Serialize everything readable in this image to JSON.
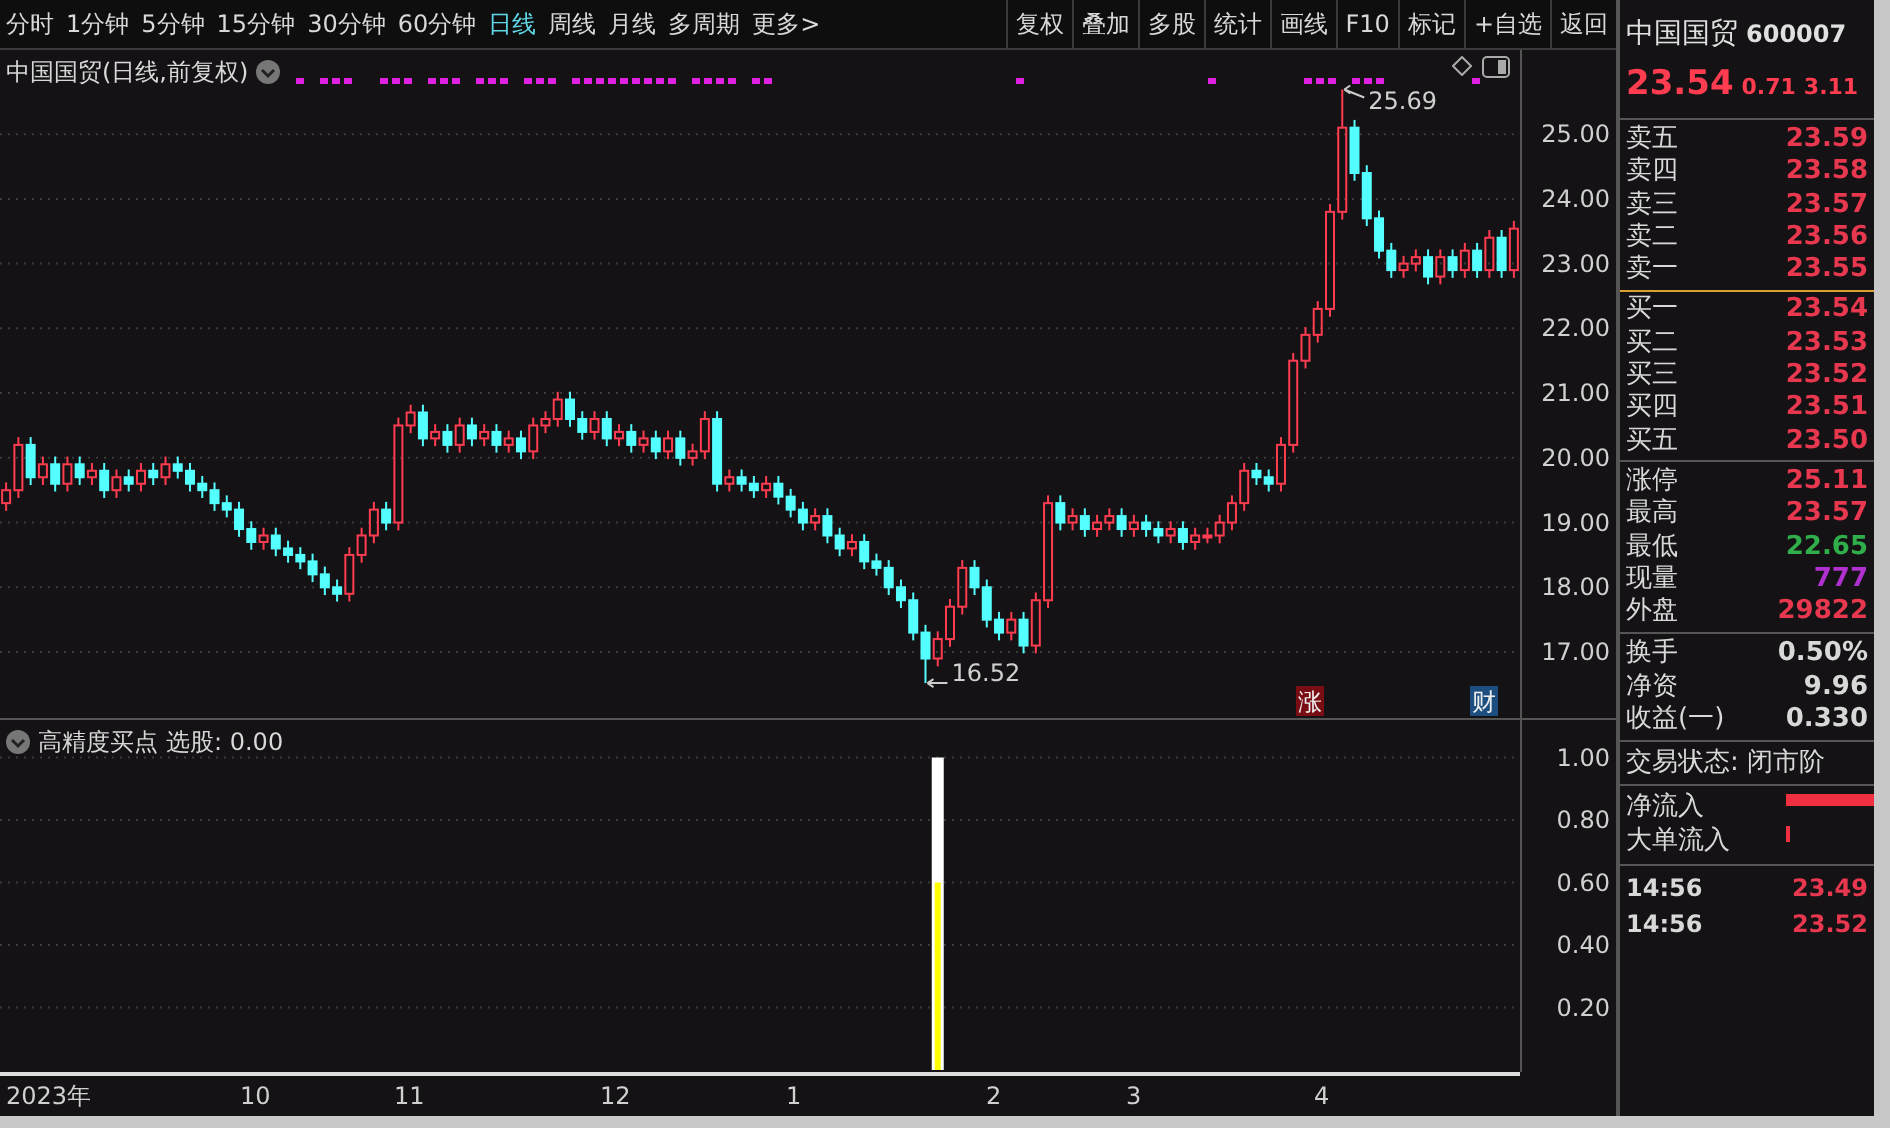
{
  "toolbar": {
    "periods": [
      {
        "label": "分时",
        "selected": false
      },
      {
        "label": "1分钟",
        "selected": false
      },
      {
        "label": "5分钟",
        "selected": false
      },
      {
        "label": "15分钟",
        "selected": false
      },
      {
        "label": "30分钟",
        "selected": false
      },
      {
        "label": "60分钟",
        "selected": false
      },
      {
        "label": "日线",
        "selected": true
      },
      {
        "label": "周线",
        "selected": false
      },
      {
        "label": "月线",
        "selected": false
      },
      {
        "label": "多周期",
        "selected": false
      },
      {
        "label": "更多>",
        "selected": false
      }
    ],
    "actions": [
      "复权",
      "叠加",
      "多股",
      "统计",
      "画线",
      "F10",
      "标记",
      "+自选",
      "返回"
    ]
  },
  "price_chart": {
    "title": "中国国贸(日线,前复权)",
    "chart_data": {
      "type": "candlestick",
      "grid": true,
      "ohlc": [
        [
          19.3,
          19.62,
          19.18,
          19.5
        ],
        [
          19.5,
          20.32,
          19.38,
          20.2
        ],
        [
          20.2,
          20.32,
          19.58,
          19.7
        ],
        [
          19.7,
          20.02,
          19.58,
          19.9
        ],
        [
          19.9,
          20.02,
          19.48,
          19.6
        ],
        [
          19.6,
          20.02,
          19.48,
          19.9
        ],
        [
          19.9,
          20.02,
          19.58,
          19.7
        ],
        [
          19.7,
          19.92,
          19.58,
          19.8
        ],
        [
          19.8,
          19.92,
          19.38,
          19.5
        ],
        [
          19.5,
          19.82,
          19.38,
          19.7
        ],
        [
          19.7,
          19.82,
          19.48,
          19.6
        ],
        [
          19.6,
          19.92,
          19.48,
          19.8
        ],
        [
          19.8,
          19.92,
          19.58,
          19.7
        ],
        [
          19.7,
          20.02,
          19.58,
          19.9
        ],
        [
          19.9,
          20.02,
          19.68,
          19.8
        ],
        [
          19.8,
          19.92,
          19.48,
          19.6
        ],
        [
          19.6,
          19.72,
          19.38,
          19.5
        ],
        [
          19.5,
          19.62,
          19.18,
          19.3
        ],
        [
          19.3,
          19.42,
          19.08,
          19.2
        ],
        [
          19.2,
          19.32,
          18.78,
          18.9
        ],
        [
          18.9,
          19.02,
          18.58,
          18.7
        ],
        [
          18.7,
          18.92,
          18.58,
          18.8
        ],
        [
          18.8,
          18.92,
          18.48,
          18.6
        ],
        [
          18.6,
          18.72,
          18.38,
          18.5
        ],
        [
          18.5,
          18.62,
          18.28,
          18.4
        ],
        [
          18.4,
          18.52,
          18.08,
          18.2
        ],
        [
          18.2,
          18.32,
          17.88,
          18.0
        ],
        [
          18.0,
          18.12,
          17.78,
          17.9
        ],
        [
          17.9,
          18.62,
          17.78,
          18.5
        ],
        [
          18.5,
          18.92,
          18.38,
          18.8
        ],
        [
          18.8,
          19.32,
          18.68,
          19.2
        ],
        [
          19.2,
          19.32,
          18.88,
          19.0
        ],
        [
          19.0,
          20.62,
          18.88,
          20.5
        ],
        [
          20.5,
          20.82,
          20.38,
          20.7
        ],
        [
          20.7,
          20.82,
          20.18,
          20.3
        ],
        [
          20.3,
          20.52,
          20.18,
          20.4
        ],
        [
          20.4,
          20.52,
          20.08,
          20.2
        ],
        [
          20.2,
          20.62,
          20.08,
          20.5
        ],
        [
          20.5,
          20.62,
          20.18,
          20.3
        ],
        [
          20.3,
          20.52,
          20.18,
          20.4
        ],
        [
          20.4,
          20.52,
          20.08,
          20.2
        ],
        [
          20.2,
          20.42,
          20.08,
          20.3
        ],
        [
          20.3,
          20.42,
          19.98,
          20.1
        ],
        [
          20.1,
          20.62,
          19.98,
          20.5
        ],
        [
          20.5,
          20.72,
          20.38,
          20.6
        ],
        [
          20.6,
          21.02,
          20.48,
          20.9
        ],
        [
          20.9,
          21.02,
          20.48,
          20.6
        ],
        [
          20.6,
          20.72,
          20.28,
          20.4
        ],
        [
          20.4,
          20.72,
          20.28,
          20.6
        ],
        [
          20.6,
          20.72,
          20.18,
          20.3
        ],
        [
          20.3,
          20.52,
          20.18,
          20.4
        ],
        [
          20.4,
          20.52,
          20.08,
          20.2
        ],
        [
          20.2,
          20.42,
          20.08,
          20.3
        ],
        [
          20.3,
          20.42,
          19.98,
          20.1
        ],
        [
          20.1,
          20.42,
          19.98,
          20.3
        ],
        [
          20.3,
          20.42,
          19.88,
          20.0
        ],
        [
          20.0,
          20.22,
          19.88,
          20.1
        ],
        [
          20.1,
          20.72,
          19.98,
          20.6
        ],
        [
          20.6,
          20.72,
          19.48,
          19.6
        ],
        [
          19.6,
          19.82,
          19.48,
          19.7
        ],
        [
          19.7,
          19.82,
          19.48,
          19.6
        ],
        [
          19.6,
          19.72,
          19.38,
          19.5
        ],
        [
          19.5,
          19.72,
          19.38,
          19.6
        ],
        [
          19.6,
          19.72,
          19.28,
          19.4
        ],
        [
          19.4,
          19.52,
          19.08,
          19.2
        ],
        [
          19.2,
          19.32,
          18.88,
          19.0
        ],
        [
          19.0,
          19.22,
          18.88,
          19.1
        ],
        [
          19.1,
          19.22,
          18.68,
          18.8
        ],
        [
          18.8,
          18.92,
          18.48,
          18.6
        ],
        [
          18.6,
          18.82,
          18.48,
          18.7
        ],
        [
          18.7,
          18.82,
          18.28,
          18.4
        ],
        [
          18.4,
          18.52,
          18.18,
          18.3
        ],
        [
          18.3,
          18.42,
          17.88,
          18.0
        ],
        [
          18.0,
          18.12,
          17.68,
          17.8
        ],
        [
          17.8,
          17.92,
          17.18,
          17.3
        ],
        [
          17.3,
          17.42,
          16.52,
          16.9
        ],
        [
          16.9,
          17.32,
          16.78,
          17.2
        ],
        [
          17.2,
          17.82,
          17.08,
          17.7
        ],
        [
          17.7,
          18.42,
          17.58,
          18.3
        ],
        [
          18.3,
          18.42,
          17.88,
          18.0
        ],
        [
          18.0,
          18.12,
          17.38,
          17.5
        ],
        [
          17.5,
          17.62,
          17.18,
          17.3
        ],
        [
          17.3,
          17.62,
          17.18,
          17.5
        ],
        [
          17.5,
          17.62,
          16.98,
          17.1
        ],
        [
          17.1,
          17.92,
          16.98,
          17.8
        ],
        [
          17.8,
          19.42,
          17.68,
          19.3
        ],
        [
          19.3,
          19.42,
          18.88,
          19.0
        ],
        [
          19.0,
          19.22,
          18.88,
          19.1
        ],
        [
          19.1,
          19.22,
          18.78,
          18.9
        ],
        [
          18.9,
          19.12,
          18.78,
          19.0
        ],
        [
          19.0,
          19.22,
          18.88,
          19.1
        ],
        [
          19.1,
          19.22,
          18.78,
          18.9
        ],
        [
          18.9,
          19.12,
          18.78,
          19.0
        ],
        [
          19.0,
          19.12,
          18.78,
          18.9
        ],
        [
          18.9,
          19.02,
          18.68,
          18.8
        ],
        [
          18.8,
          19.02,
          18.68,
          18.9
        ],
        [
          18.9,
          19.02,
          18.58,
          18.7
        ],
        [
          18.7,
          18.92,
          18.58,
          18.8
        ],
        [
          18.8,
          18.92,
          18.68,
          18.8
        ],
        [
          18.8,
          19.12,
          18.68,
          19.0
        ],
        [
          19.0,
          19.42,
          18.88,
          19.3
        ],
        [
          19.3,
          19.92,
          19.18,
          19.8
        ],
        [
          19.8,
          19.92,
          19.58,
          19.7
        ],
        [
          19.7,
          19.82,
          19.48,
          19.6
        ],
        [
          19.6,
          20.32,
          19.48,
          20.2
        ],
        [
          20.2,
          21.62,
          20.08,
          21.5
        ],
        [
          21.5,
          22.02,
          21.38,
          21.9
        ],
        [
          21.9,
          22.42,
          21.78,
          22.3
        ],
        [
          22.3,
          23.92,
          22.18,
          23.8
        ],
        [
          23.8,
          25.69,
          23.68,
          25.1
        ],
        [
          25.1,
          25.22,
          24.28,
          24.4
        ],
        [
          24.4,
          24.52,
          23.58,
          23.7
        ],
        [
          23.7,
          23.82,
          23.08,
          23.2
        ],
        [
          23.2,
          23.32,
          22.78,
          22.9
        ],
        [
          22.9,
          23.12,
          22.78,
          23.0
        ],
        [
          23.0,
          23.22,
          22.88,
          23.1
        ],
        [
          23.1,
          23.22,
          22.68,
          22.8
        ],
        [
          22.8,
          23.22,
          22.68,
          23.1
        ],
        [
          23.1,
          23.22,
          22.78,
          22.9
        ],
        [
          22.9,
          23.32,
          22.78,
          23.2
        ],
        [
          23.2,
          23.32,
          22.78,
          22.9
        ],
        [
          22.9,
          23.52,
          22.78,
          23.4
        ],
        [
          23.4,
          23.52,
          22.78,
          22.9
        ],
        [
          22.9,
          23.66,
          22.78,
          23.54
        ]
      ],
      "ylim": [
        15.95,
        26.3
      ],
      "yticks": [
        {
          "value": 17,
          "label": "17.00"
        },
        {
          "value": 18,
          "label": "18.00"
        },
        {
          "value": 19,
          "label": "19.00"
        },
        {
          "value": 20,
          "label": "20.00"
        },
        {
          "value": 21,
          "label": "21.00"
        },
        {
          "value": 22,
          "label": "22.00"
        },
        {
          "value": 23,
          "label": "23.00"
        },
        {
          "value": 24,
          "label": "24.00"
        },
        {
          "value": 25,
          "label": "25.00"
        }
      ],
      "annotations": [
        "25.69",
        "16.52",
        "涨",
        "财"
      ]
    }
  },
  "time_axis": {
    "labels": [
      "2023年",
      "10",
      "11",
      "12",
      "1",
      "2",
      "3",
      "4"
    ]
  },
  "indicator_chart": {
    "name": "高精度买点",
    "reading": "选股: 0.00",
    "chart_data": {
      "type": "bar",
      "grid": true,
      "ylim": [
        0,
        1.12
      ],
      "yticks": [
        {
          "value": 0.2,
          "label": "0.20"
        },
        {
          "value": 0.4,
          "label": "0.40"
        },
        {
          "value": 0.6,
          "label": "0.60"
        },
        {
          "value": 0.8,
          "label": "0.80"
        },
        {
          "value": 1,
          "label": "1.00"
        }
      ],
      "series": [
        {
          "color": "#ffffff",
          "values": [
            0,
            0,
            0,
            0,
            0,
            0,
            0,
            0,
            0,
            0,
            0,
            0,
            0,
            0,
            0,
            0,
            0,
            0,
            0,
            0,
            0,
            0,
            0,
            0,
            0,
            0,
            0,
            0,
            0,
            0,
            0,
            0,
            0,
            0,
            0,
            0,
            0,
            0,
            0,
            0,
            0,
            0,
            0,
            0,
            0,
            0,
            0,
            0,
            0,
            0,
            0,
            0,
            0,
            0,
            0,
            0,
            0,
            0,
            0,
            0,
            0,
            0,
            0,
            0,
            0,
            0,
            0,
            0,
            0,
            0,
            0,
            0,
            0,
            0,
            0,
            0,
            1,
            0,
            0,
            0,
            0,
            0,
            0,
            0,
            0,
            0,
            0,
            0,
            0,
            0,
            0,
            0,
            0,
            0,
            0,
            0,
            0,
            0,
            0,
            0,
            0,
            0,
            0,
            0,
            0,
            0,
            0,
            0,
            0,
            0,
            0,
            0,
            0,
            0,
            0,
            0,
            0,
            0,
            0,
            0,
            0,
            0,
            0,
            0
          ]
        },
        {
          "color": "#ffff00",
          "values": [
            0,
            0,
            0,
            0,
            0,
            0,
            0,
            0,
            0,
            0,
            0,
            0,
            0,
            0,
            0,
            0,
            0,
            0,
            0,
            0,
            0,
            0,
            0,
            0,
            0,
            0,
            0,
            0,
            0,
            0,
            0,
            0,
            0,
            0,
            0,
            0,
            0,
            0,
            0,
            0,
            0,
            0,
            0,
            0,
            0,
            0,
            0,
            0,
            0,
            0,
            0,
            0,
            0,
            0,
            0,
            0,
            0,
            0,
            0,
            0,
            0,
            0,
            0,
            0,
            0,
            0,
            0,
            0,
            0,
            0,
            0,
            0,
            0,
            0,
            0,
            0,
            0.6,
            0,
            0,
            0,
            0,
            0,
            0,
            0,
            0,
            0,
            0,
            0,
            0,
            0,
            0,
            0,
            0,
            0,
            0,
            0,
            0,
            0,
            0,
            0,
            0,
            0,
            0,
            0,
            0,
            0,
            0,
            0,
            0,
            0,
            0,
            0,
            0,
            0,
            0,
            0,
            0,
            0,
            0,
            0,
            0,
            0,
            0,
            0
          ]
        }
      ]
    }
  },
  "quote_panel": {
    "name": "中国国贸",
    "code": "600007",
    "price": "23.54",
    "change": "0.71",
    "change_pct": "3.11",
    "asks": [
      {
        "label": "卖五",
        "price": "23.59"
      },
      {
        "label": "卖四",
        "price": "23.58"
      },
      {
        "label": "卖三",
        "price": "23.57"
      },
      {
        "label": "卖二",
        "price": "23.56"
      },
      {
        "label": "卖一",
        "price": "23.55"
      }
    ],
    "bids": [
      {
        "label": "买一",
        "price": "23.54"
      },
      {
        "label": "买二",
        "price": "23.53"
      },
      {
        "label": "买三",
        "price": "23.52"
      },
      {
        "label": "买四",
        "price": "23.51"
      },
      {
        "label": "买五",
        "price": "23.50"
      }
    ],
    "stats": [
      {
        "label": "涨停",
        "value": "25.11",
        "color": "#e8384f"
      },
      {
        "label": "最高",
        "value": "23.57",
        "color": "#e8384f"
      },
      {
        "label": "最低",
        "value": "22.65",
        "color": "#2fae4a"
      },
      {
        "label": "现量",
        "value": "777",
        "color": "#b030d0"
      },
      {
        "label": "外盘",
        "value": "29822",
        "color": "#e8384f"
      }
    ],
    "fundamentals": [
      {
        "label": "换手",
        "value": "0.50%"
      },
      {
        "label": "净资",
        "value": "9.96"
      },
      {
        "label": "收益(一)",
        "value": "0.330"
      }
    ],
    "trade_status": "交易状态: 闭市阶",
    "flows": [
      {
        "label": "净流入"
      },
      {
        "label": "大单流入"
      }
    ],
    "ticks": [
      {
        "time": "14:56",
        "price": "23.49"
      },
      {
        "time": "14:56",
        "price": "23.52"
      }
    ]
  }
}
